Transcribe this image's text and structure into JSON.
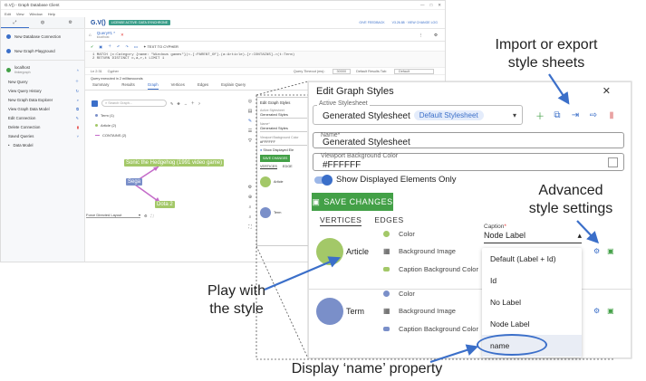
{
  "app": {
    "window_title": "G.V() - Graph Database Client",
    "menu": [
      "Edit",
      "View",
      "Window",
      "Help"
    ],
    "logo": "G.V()",
    "license_tag": "LICENSE ACTIVE: DATA SYNCHRONE",
    "top_links": [
      "GIVE FEEDBACK",
      "V3.26.88 · VIEW CHANGE LOG"
    ]
  },
  "sidebar": {
    "items": [
      {
        "label": "New Database Connection"
      },
      {
        "label": "New Graph Playground"
      },
      {
        "label": "localhost",
        "sub": "tinkergraph"
      },
      {
        "label": "New Query"
      },
      {
        "label": "View Query History"
      },
      {
        "label": "New Graph Data Explorer"
      },
      {
        "label": "View Graph Data Model"
      },
      {
        "label": "Edit Connection"
      },
      {
        "label": "Delete Connection"
      },
      {
        "label": "Saved Queries"
      },
      {
        "label": "Data Model"
      }
    ]
  },
  "query": {
    "tab_label": "Query#1 *",
    "tab_sub": "localhost",
    "toolbar_text": "TEXT TO CYPHER",
    "code_line1": "1  MATCH (c:Category {name: \"Windows games\"})<-[:PARENT_OF]-(a:Article)-[r:CONTAINS]->(t:Term)",
    "code_line2": "2  RETURN DISTINCT c,a,r,t LIMIT 1",
    "pos": "Ln 2:31",
    "lang": "Cypher",
    "timeout_label": "Query Timeout (ms):",
    "timeout_value": "30000",
    "result_tab_label": "Default Results Tab:",
    "result_tab_value": "Default",
    "executed": "Query executed in 2 millisecconds",
    "result_tabs": [
      "Summary",
      "Results",
      "Graph",
      "Vertices",
      "Edges",
      "Explain Query"
    ]
  },
  "graph": {
    "search_placeholder": "Search Graph...",
    "legend": [
      "Term (1)",
      "Article (2)",
      "CONTAINS (2)"
    ],
    "nodes": [
      "Sonic the Hedgehog (1991 video game)",
      "Sega",
      "Dota 2"
    ],
    "layout": "Force Directed Layout"
  },
  "small_styles": {
    "title": "Edit Graph Styles",
    "stylesheet_label": "Active Stylesheet",
    "stylesheet": "Generated Styles",
    "name_label": "Name*",
    "name": "Generated Styles",
    "bg_label": "Viewport Background Color",
    "bg": "#FFFFFF",
    "toggle": "Show Displayed Ele",
    "save": "SAVE CHANGES",
    "tabs": [
      "VERTICES",
      "EDGE"
    ],
    "rows": [
      "Article",
      "Term"
    ]
  },
  "dialog": {
    "title": "Edit Graph Styles",
    "close": "✕",
    "active_stylesheet_label": "Active Stylesheet",
    "active_stylesheet": "Generated Stylesheet",
    "default_pill": "Default Stylesheet",
    "name_label": "Name*",
    "name_value": "Generated Stylesheet",
    "bg_label": "Viewport Background Color",
    "bg_value": "#FFFFFF",
    "toggle_label": "Show Displayed Elements Only",
    "save_label": "SAVE CHANGES",
    "tabs": [
      "VERTICES",
      "EDGES"
    ],
    "rows": [
      {
        "name": "Article",
        "color": "#a3c868",
        "props": [
          "Color",
          "Background Image",
          "Caption Background Color"
        ]
      },
      {
        "name": "Term",
        "color": "#7a8fc9",
        "props": [
          "Color",
          "Background Image",
          "Caption Background Color"
        ]
      }
    ],
    "caption_label": "Caption",
    "caption_value": "Node Label",
    "options": [
      "Default (Label + Id)",
      "Id",
      "No Label",
      "Node Label",
      "name"
    ]
  },
  "annotations": {
    "import_export": "Import or export\nstyle sheets",
    "advanced": "Advanced\nstyle settings",
    "play": "Play with\nthe style",
    "display_name": "Display ‘name’ property"
  },
  "colors": {
    "accent": "#3b6fc9",
    "save_green": "#43a047",
    "article_green": "#a3c868",
    "term_blue": "#7a8fc9",
    "danger": "#e53935"
  }
}
